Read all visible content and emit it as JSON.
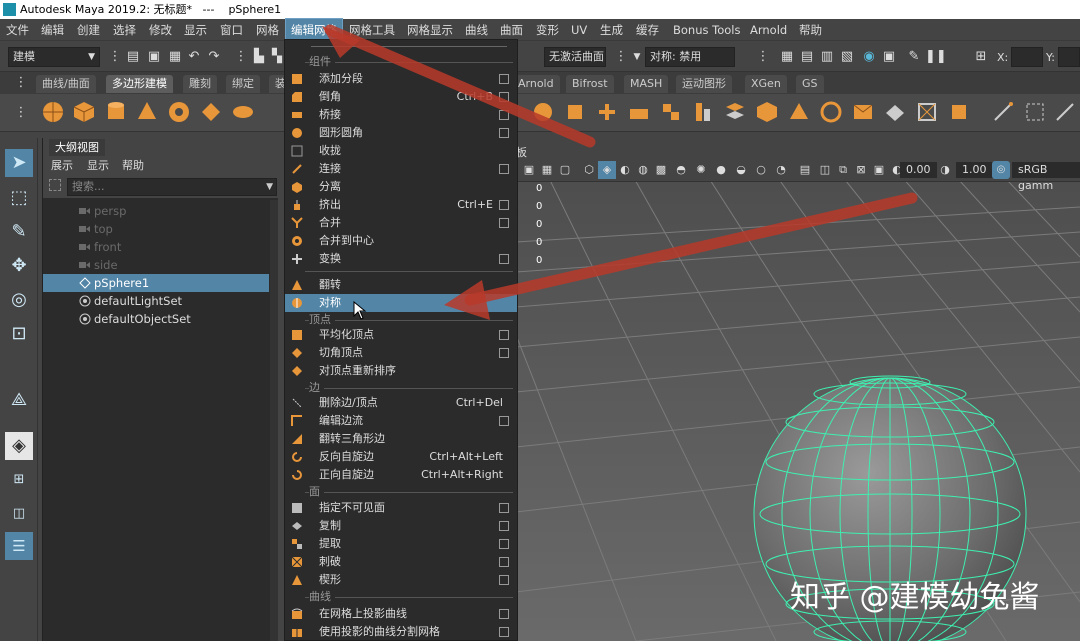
{
  "titlebar": {
    "text": "Autodesk Maya 2019.2: 无标题*   ---    pSphere1"
  },
  "menubar": {
    "items": [
      "文件",
      "编辑",
      "创建",
      "选择",
      "修改",
      "显示",
      "窗口",
      "网格",
      "编辑网格",
      "网格工具",
      "网格显示",
      "曲线",
      "曲面",
      "变形",
      "UV",
      "生成",
      "缓存",
      "Bonus Tools",
      "Arnold",
      "帮助"
    ]
  },
  "statusline": {
    "mode": "建模",
    "curve_state": "无激活曲面",
    "symmetry": "对称: 禁用",
    "x_label": "X:",
    "y_label": "Y:"
  },
  "shelf": {
    "tabs_left": [
      "曲线/曲面",
      "多边形建模",
      "雕刻",
      "绑定",
      "装"
    ],
    "tabs_right": [
      "Arnold",
      "Bifrost",
      "MASH",
      "运动图形",
      "XGen",
      "GS"
    ]
  },
  "outliner": {
    "title": "大纲视图",
    "menu": [
      "展示",
      "显示",
      "帮助"
    ],
    "search_placeholder": "搜索...",
    "items": [
      "persp",
      "top",
      "front",
      "side",
      "pSphere1",
      "defaultLightSet",
      "defaultObjectSet"
    ]
  },
  "viewport": {
    "panel_label": "板",
    "field1": "0.00",
    "field2": "1.00",
    "colorspace": "sRGB gamm",
    "hud_values": [
      "0",
      "0",
      "0",
      "0",
      "0"
    ]
  },
  "dropdown": {
    "sections": {
      "components": "组件",
      "vertex": "顶点",
      "edge": "边",
      "face": "面",
      "curve": "曲线"
    },
    "items": [
      {
        "label": "添加分段",
        "shortcut": ""
      },
      {
        "label": "倒角",
        "shortcut": "Ctrl+B"
      },
      {
        "label": "桥接",
        "shortcut": ""
      },
      {
        "label": "圆形圆角",
        "shortcut": ""
      },
      {
        "label": "收拢",
        "shortcut": ""
      },
      {
        "label": "连接",
        "shortcut": ""
      },
      {
        "label": "分离",
        "shortcut": ""
      },
      {
        "label": "挤出",
        "shortcut": "Ctrl+E"
      },
      {
        "label": "合并",
        "shortcut": ""
      },
      {
        "label": "合并到中心",
        "shortcut": ""
      },
      {
        "label": "变换",
        "shortcut": ""
      },
      {
        "label": "翻转",
        "shortcut": ""
      },
      {
        "label": "对称",
        "shortcut": ""
      },
      {
        "label": "平均化顶点",
        "shortcut": ""
      },
      {
        "label": "切角顶点",
        "shortcut": ""
      },
      {
        "label": "对顶点重新排序",
        "shortcut": ""
      },
      {
        "label": "删除边/顶点",
        "shortcut": "Ctrl+Del"
      },
      {
        "label": "编辑边流",
        "shortcut": ""
      },
      {
        "label": "翻转三角形边",
        "shortcut": ""
      },
      {
        "label": "反向自旋边",
        "shortcut": "Ctrl+Alt+Left"
      },
      {
        "label": "正向自旋边",
        "shortcut": "Ctrl+Alt+Right"
      },
      {
        "label": "指定不可见面",
        "shortcut": ""
      },
      {
        "label": "复制",
        "shortcut": ""
      },
      {
        "label": "提取",
        "shortcut": ""
      },
      {
        "label": "刺破",
        "shortcut": ""
      },
      {
        "label": "楔形",
        "shortcut": ""
      },
      {
        "label": "在网格上投影曲线",
        "shortcut": ""
      },
      {
        "label": "使用投影的曲线分割网格",
        "shortcut": ""
      }
    ]
  },
  "watermark": "知乎 @建模幼兔酱",
  "colors": {
    "accent": "#5285a6",
    "menu_bg": "#2b2b2b",
    "wire": "#3ef0b0",
    "arrow": "#b83a2a"
  }
}
